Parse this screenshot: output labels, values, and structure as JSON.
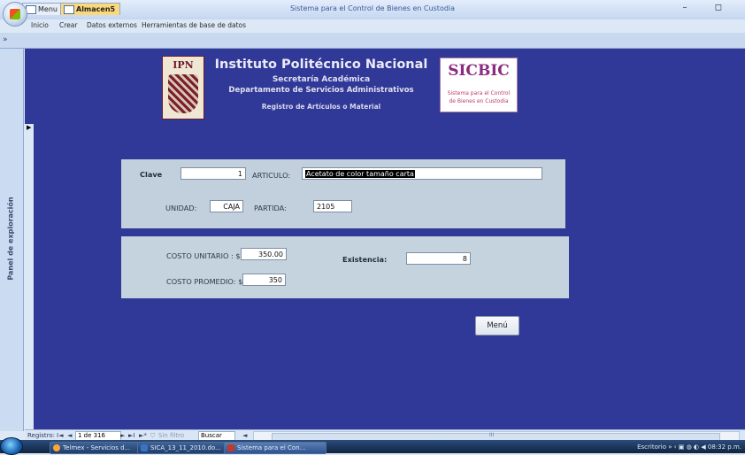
{
  "window": {
    "title": "Sistema para el Control de Bienes en Custodia",
    "quick_access": "↶ · ↷ · ▾",
    "controls": "– ◻"
  },
  "ribbon": {
    "tabs": [
      "Inicio",
      "Crear",
      "Datos externos",
      "Herramientas de base de datos"
    ]
  },
  "doc_tabs": {
    "chevron": "»",
    "menu": "Menu",
    "almacen": "Almacen5"
  },
  "nav_pane": {
    "label": "Panel de exploración"
  },
  "header": {
    "ipn_logo_text": "IPN",
    "institute": "Instituto Politécnico Nacional",
    "secretaria": "Secretaría Académica",
    "departamento": "Departamento de Servicios Administrativos",
    "registro": "Registro de Artículos o Material",
    "sicbic_logo": "SICBIC",
    "sicbic_caption_1": "Sistema para el Control",
    "sicbic_caption_2": "de Bienes en Custodia"
  },
  "form": {
    "clave_label": "Clave",
    "clave_value": "1",
    "articulo_label": "ARTICULO:",
    "articulo_value": "Acetato de color tamaño carta",
    "unidad_label": "UNIDAD:",
    "unidad_value": "CAJA",
    "partida_label": "PARTIDA:",
    "partida_value": "2105",
    "costo_unitario_label": "COSTO UNITARIO : $",
    "costo_unitario_value": "350.00",
    "costo_promedio_label": "COSTO PROMEDIO: $",
    "costo_promedio_value": "350",
    "existencia_label": "Existencia:",
    "existencia_value": "8",
    "menu_button": "Menú"
  },
  "record_nav": {
    "label": "Registro:",
    "first": "I◄",
    "prev": "◄",
    "position": "1 de 316",
    "next": "►",
    "last": "►I",
    "new": "►*",
    "filter": "Sin filtro",
    "search": "Buscar",
    "scroll_marker": "III"
  },
  "taskbar": {
    "items": [
      "Telmex - Servicios d...",
      "SICA_13_11_2010.do...",
      "Sistema para el Con..."
    ],
    "tray_label": "Escritorio",
    "clock": "08:32 p.m."
  }
}
